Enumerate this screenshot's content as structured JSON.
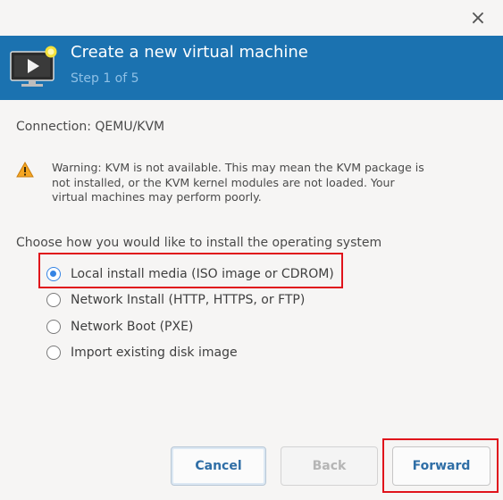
{
  "window": {
    "close_glyph": "×"
  },
  "header": {
    "title": "Create a new virtual machine",
    "subtitle": "Step 1 of 5",
    "icon": "virtual-machine-icon",
    "background_color": "#1b72b0"
  },
  "connection": {
    "text": "Connection:  QEMU/KVM"
  },
  "warning": {
    "icon": "warning-icon",
    "text": "Warning: KVM is not available. This may mean the KVM package is not installed, or the KVM kernel modules are not loaded. Your virtual machines may perform poorly."
  },
  "install": {
    "label": "Choose how you would like to install the operating system",
    "options": [
      {
        "label": "Local install media (ISO image or CDROM)",
        "selected": true
      },
      {
        "label": "Network Install (HTTP, HTTPS, or FTP)",
        "selected": false
      },
      {
        "label": "Network Boot (PXE)",
        "selected": false
      },
      {
        "label": "Import existing disk image",
        "selected": false
      }
    ]
  },
  "buttons": {
    "cancel": "Cancel",
    "back": "Back",
    "forward": "Forward"
  },
  "colors": {
    "accent": "#3584e4",
    "highlight": "#e0131b"
  }
}
